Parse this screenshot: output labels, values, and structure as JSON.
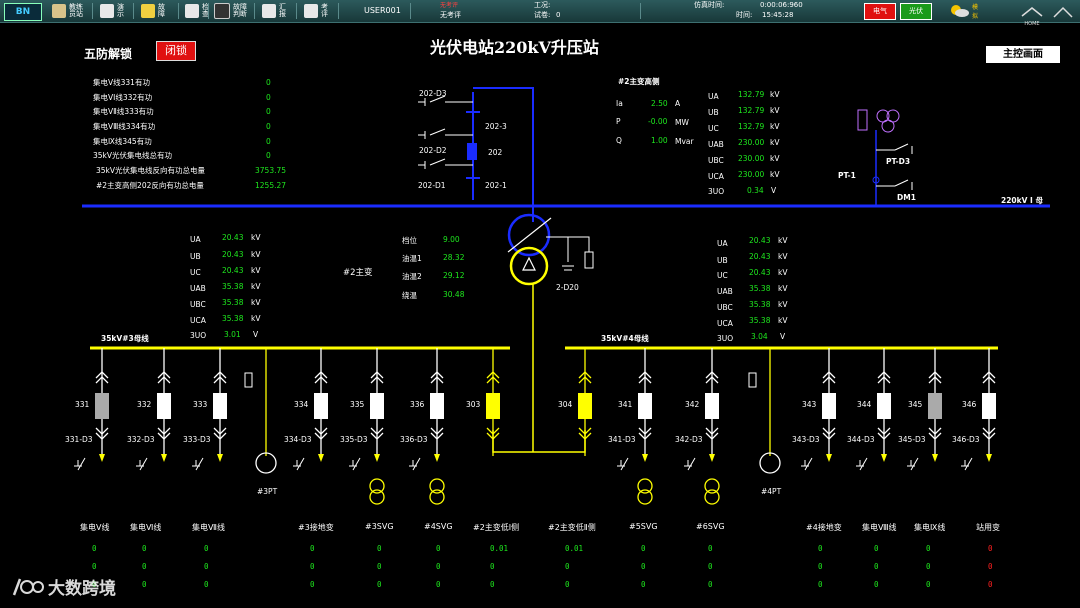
{
  "toolbar": {
    "items": [
      {
        "label": "教练\n员站",
        "icon": "trainer-station-icon"
      },
      {
        "label": "演\n示",
        "icon": "demo-folder-icon"
      },
      {
        "label": "故\n障",
        "icon": "fault-icon"
      },
      {
        "label": "检\n查",
        "icon": "check-icon"
      },
      {
        "label": "故障\n判断",
        "icon": "fault-judge-icon"
      },
      {
        "label": "汇\n报",
        "icon": "report-icon"
      },
      {
        "label": "考\n评",
        "icon": "evaluate-icon"
      }
    ],
    "user": "USER001",
    "status_top": "无考评",
    "status_bottom": "无考评",
    "work_label": "工况:",
    "work_value": "",
    "exam_label": "试卷:",
    "exam_value": "0",
    "sim_time_label": "仿真时间:",
    "sim_time_value": "0:00:06:960",
    "time_label": "时间:",
    "time_value": "15:45:28",
    "btn_electric": "电气",
    "btn_pv": "光伏",
    "weather_label": "模\n拟",
    "home_label": "HOME"
  },
  "page": {
    "title": "光伏电站220kV升压站",
    "wufang": "五防解锁",
    "lock_btn": "闭锁",
    "main_btn": "主控画面"
  },
  "power_list": [
    {
      "label": "集电V线331有功",
      "value": "0"
    },
    {
      "label": "集电VⅠ线332有功",
      "value": "0"
    },
    {
      "label": "集电VⅡ线333有功",
      "value": "0"
    },
    {
      "label": "集电VⅢ线334有功",
      "value": "0"
    },
    {
      "label": "集电Ⅸ线345有功",
      "value": "0"
    },
    {
      "label": "35kV光伏集电线总有功",
      "value": "0"
    },
    {
      "label": "35kV光伏集电线反向有功总电量",
      "value": "3753.75"
    },
    {
      "label": "#2主变高侧202反向有功总电量",
      "value": "1255.27"
    }
  ],
  "high_side": {
    "title": "#2主变高侧",
    "rows": [
      {
        "label": "Ia",
        "value": "2.50",
        "unit": "A"
      },
      {
        "label": "P",
        "value": "-0.00",
        "unit": "MW"
      },
      {
        "label": "Q",
        "value": "1.00",
        "unit": "Mvar"
      }
    ]
  },
  "hv_bus_volt": [
    {
      "label": "UA",
      "value": "132.79",
      "unit": "kV"
    },
    {
      "label": "UB",
      "value": "132.79",
      "unit": "kV"
    },
    {
      "label": "UC",
      "value": "132.79",
      "unit": "kV"
    },
    {
      "label": "UAB",
      "value": "230.00",
      "unit": "kV"
    },
    {
      "label": "UBC",
      "value": "230.00",
      "unit": "kV"
    },
    {
      "label": "UCA",
      "value": "230.00",
      "unit": "kV"
    },
    {
      "label": "3UO",
      "value": "0.34",
      "unit": "V"
    }
  ],
  "bus3_volt": [
    {
      "label": "UA",
      "value": "20.43",
      "unit": "kV"
    },
    {
      "label": "UB",
      "value": "20.43",
      "unit": "kV"
    },
    {
      "label": "UC",
      "value": "20.43",
      "unit": "kV"
    },
    {
      "label": "UAB",
      "value": "35.38",
      "unit": "kV"
    },
    {
      "label": "UBC",
      "value": "35.38",
      "unit": "kV"
    },
    {
      "label": "UCA",
      "value": "35.38",
      "unit": "kV"
    },
    {
      "label": "3UO",
      "value": "3.01",
      "unit": "V"
    }
  ],
  "bus4_volt": [
    {
      "label": "UA",
      "value": "20.43",
      "unit": "kV"
    },
    {
      "label": "UB",
      "value": "20.43",
      "unit": "kV"
    },
    {
      "label": "UC",
      "value": "20.43",
      "unit": "kV"
    },
    {
      "label": "UAB",
      "value": "35.38",
      "unit": "kV"
    },
    {
      "label": "UBC",
      "value": "35.38",
      "unit": "kV"
    },
    {
      "label": "UCA",
      "value": "35.38",
      "unit": "kV"
    },
    {
      "label": "3UO",
      "value": "3.04",
      "unit": "V"
    }
  ],
  "transformer": {
    "name": "#2主变",
    "rows": [
      {
        "label": "档位",
        "value": "9.00"
      },
      {
        "label": "油温1",
        "value": "28.32"
      },
      {
        "label": "油温2",
        "value": "29.12"
      },
      {
        "label": "绕温",
        "value": "30.48"
      }
    ],
    "ground_label": "2-D20"
  },
  "diagram_labels": {
    "d3_202": "202-D3",
    "s202_3": "202-3",
    "d2_202": "202-D2",
    "b202": "202",
    "d1_202": "202-D1",
    "s202_1": "202-1",
    "hv_bus": "220kV Ⅰ 母",
    "pt_d3": "PT-D3",
    "pt1": "PT-1",
    "dm1": "DM1",
    "bus3": "35kV#3母线",
    "bus4": "35kV#4母线",
    "pt3": "#3PT",
    "pt4": "#4PT"
  },
  "breakers": [
    {
      "no": "331",
      "gnd": "331-D3"
    },
    {
      "no": "332",
      "gnd": "332-D3"
    },
    {
      "no": "333",
      "gnd": "333-D3"
    },
    {
      "no": "334",
      "gnd": "334-D3"
    },
    {
      "no": "335",
      "gnd": "335-D3"
    },
    {
      "no": "336",
      "gnd": "336-D3"
    },
    {
      "no": "303",
      "gnd": ""
    },
    {
      "no": "304",
      "gnd": ""
    },
    {
      "no": "341",
      "gnd": "341-D3"
    },
    {
      "no": "342",
      "gnd": "342-D3"
    },
    {
      "no": "343",
      "gnd": "343-D3"
    },
    {
      "no": "344",
      "gnd": "344-D3"
    },
    {
      "no": "345",
      "gnd": "345-D3"
    },
    {
      "no": "346",
      "gnd": "346-D3"
    }
  ],
  "feeders": [
    {
      "name": "集电V线",
      "v": [
        "0",
        "0",
        "0"
      ],
      "red": false
    },
    {
      "name": "集电Ⅵ线",
      "v": [
        "0",
        "0",
        "0"
      ],
      "red": false
    },
    {
      "name": "集电Ⅶ线",
      "v": [
        "0",
        "0",
        "0"
      ],
      "red": false
    },
    {
      "name": "#3接地变",
      "v": [
        "0",
        "0",
        "0"
      ],
      "red": false
    },
    {
      "name": "#3SVG",
      "v": [
        "0",
        "0",
        "0"
      ],
      "red": false
    },
    {
      "name": "#4SVG",
      "v": [
        "0",
        "0",
        "0"
      ],
      "red": false
    },
    {
      "name": "#2主变低Ⅰ侧",
      "v": [
        "0.01",
        "0",
        "0"
      ],
      "red": false
    },
    {
      "name": "#2主变低Ⅱ侧",
      "v": [
        "0.01",
        "0",
        "0"
      ],
      "red": false
    },
    {
      "name": "#5SVG",
      "v": [
        "0",
        "0",
        "0"
      ],
      "red": false
    },
    {
      "name": "#6SVG",
      "v": [
        "0",
        "0",
        "0"
      ],
      "red": false
    },
    {
      "name": "#4接地变",
      "v": [
        "0",
        "0",
        "0"
      ],
      "red": false
    },
    {
      "name": "集电Ⅷ线",
      "v": [
        "0",
        "0",
        "0"
      ],
      "red": false
    },
    {
      "name": "集电Ⅸ线",
      "v": [
        "0",
        "0",
        "0"
      ],
      "red": false
    },
    {
      "name": "站用变",
      "v": [
        "0",
        "0",
        "0"
      ],
      "red": true
    }
  ],
  "watermark": "大数跨境",
  "colors": {
    "bus_blue": "#1a2cff",
    "bus_yellow": "#ffff00",
    "value_green": "#1ee81e",
    "lock_red": "#e01010"
  }
}
